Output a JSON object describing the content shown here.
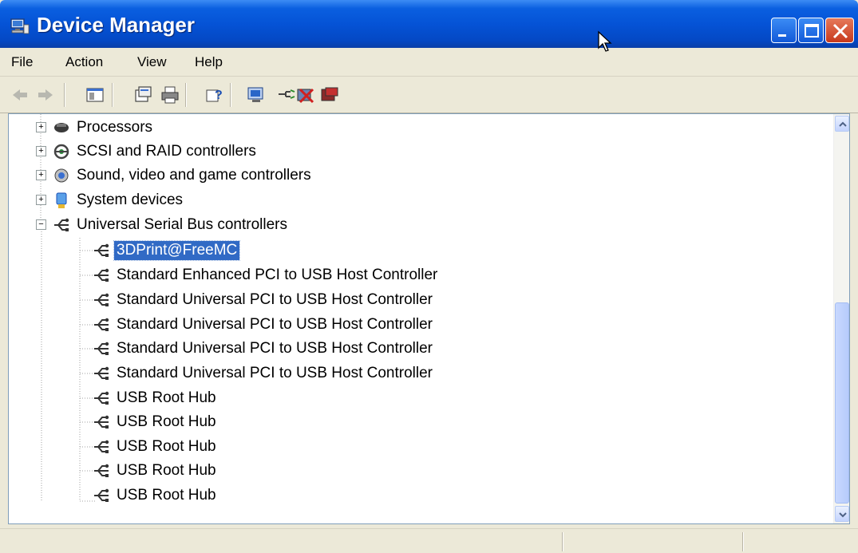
{
  "window": {
    "title": "Device Manager",
    "colors": {
      "titlebar": "#0553d6",
      "selection": "#316ac5",
      "close_button": "#c7391c"
    }
  },
  "menu": {
    "items": [
      "File",
      "Action",
      "View",
      "Help"
    ]
  },
  "toolbar": {
    "icons": [
      "back-arrow-icon",
      "forward-arrow-icon",
      "console-tree-icon",
      "properties-icon",
      "print-icon",
      "help-icon",
      "scan-hardware-icon",
      "update-driver-icon",
      "uninstall-icon",
      "disable-icon"
    ]
  },
  "tree": {
    "categories": [
      {
        "label": "Processors",
        "icon": "processor-icon",
        "expanded": false
      },
      {
        "label": "SCSI and RAID controllers",
        "icon": "scsi-icon",
        "expanded": false
      },
      {
        "label": "Sound, video and game controllers",
        "icon": "sound-icon",
        "expanded": false
      },
      {
        "label": "System devices",
        "icon": "system-devices-icon",
        "expanded": false
      },
      {
        "label": "Universal Serial Bus controllers",
        "icon": "usb-icon",
        "expanded": true
      }
    ],
    "usb_children": [
      {
        "label": "3DPrint@FreeMC",
        "selected": true
      },
      {
        "label": "Standard Enhanced PCI to USB Host Controller",
        "selected": false
      },
      {
        "label": "Standard Universal PCI to USB Host Controller",
        "selected": false
      },
      {
        "label": "Standard Universal PCI to USB Host Controller",
        "selected": false
      },
      {
        "label": "Standard Universal PCI to USB Host Controller",
        "selected": false
      },
      {
        "label": "Standard Universal PCI to USB Host Controller",
        "selected": false
      },
      {
        "label": "USB Root Hub",
        "selected": false
      },
      {
        "label": "USB Root Hub",
        "selected": false
      },
      {
        "label": "USB Root Hub",
        "selected": false
      },
      {
        "label": "USB Root Hub",
        "selected": false
      },
      {
        "label": "USB Root Hub",
        "selected": false
      }
    ]
  },
  "statusbar": {
    "text": ""
  }
}
